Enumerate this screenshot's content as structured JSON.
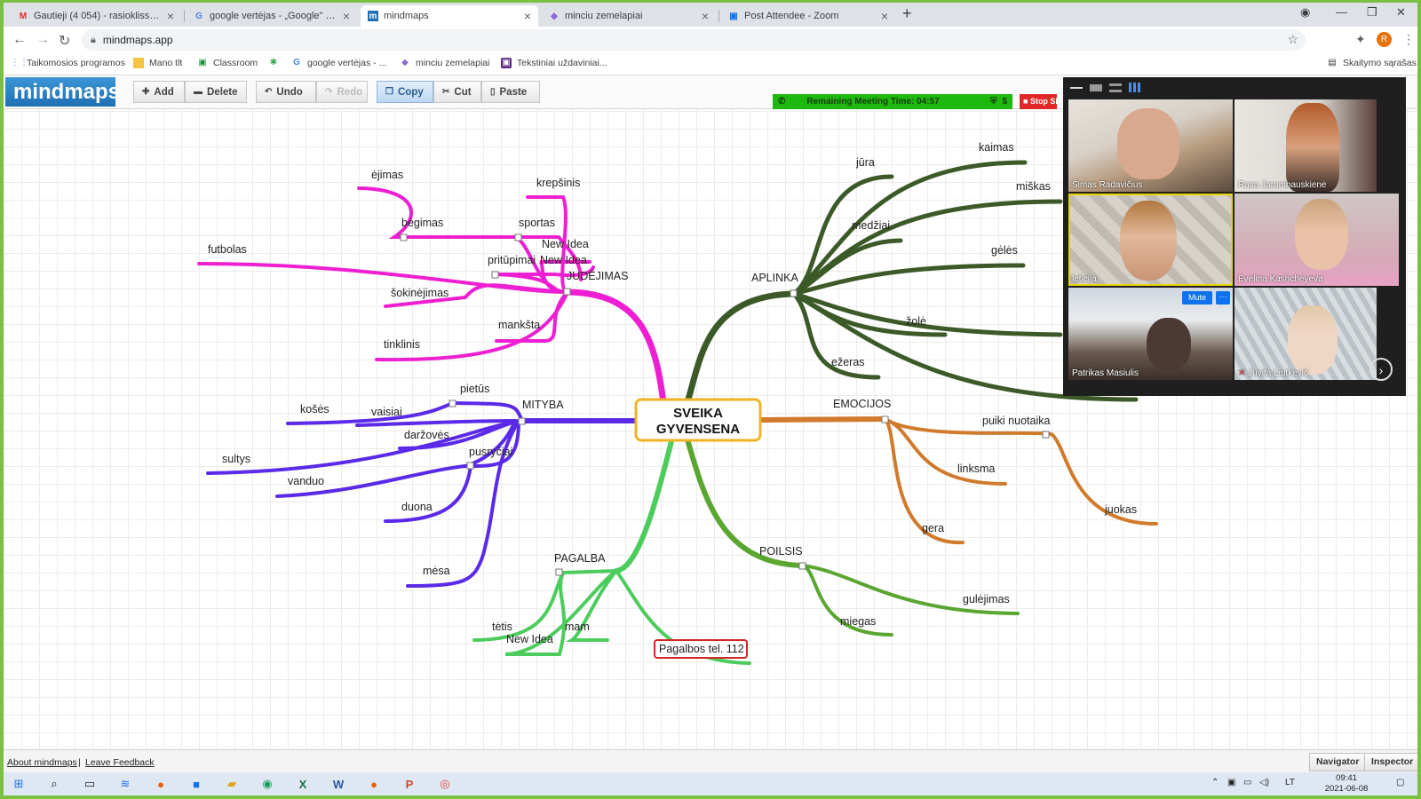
{
  "browser": {
    "tabs": [
      {
        "title": "Gautieji (4 054) - rasioklisster@g",
        "icon": "gmail-icon",
        "color": "#d93025",
        "glyph": "M"
      },
      {
        "title": "google vertėjas - „Google\" paieš",
        "icon": "google-icon",
        "color": "#4285f4",
        "glyph": "G"
      },
      {
        "title": "mindmaps",
        "icon": "mindmaps-icon",
        "color": "#1f6fb3",
        "glyph": "m",
        "active": true
      },
      {
        "title": "minciu zemelapiai",
        "icon": "drive-icon",
        "color": "#8c6ad0",
        "glyph": "◆"
      },
      {
        "title": "Post Attendee - Zoom",
        "icon": "zoom-icon",
        "color": "#0e72ed",
        "glyph": "▣"
      }
    ],
    "url": "mindmaps.app",
    "profile_initial": "R",
    "bookmarks": [
      {
        "label": "Taikomosios programos",
        "icon": "apps-icon",
        "glyph": "⋮⋮"
      },
      {
        "label": "Mano tlt",
        "icon": "folder-icon",
        "glyph": "▬"
      },
      {
        "label": "Classroom",
        "icon": "classroom-icon",
        "glyph": "▣"
      },
      {
        "label": "",
        "icon": "pinwheel-icon",
        "glyph": "✱"
      },
      {
        "label": "google vertėjas - ...",
        "icon": "google-icon",
        "glyph": "G"
      },
      {
        "label": "minciu zemelapiai",
        "icon": "drive-icon",
        "glyph": "◆"
      },
      {
        "label": "Tekstiniai uždaviniai...",
        "icon": "edu-icon",
        "glyph": "▣"
      }
    ],
    "reading_list": "Skaitymo sąrašas"
  },
  "toolbar": {
    "logo": "mindmaps",
    "add": "Add",
    "delete": "Delete",
    "undo": "Undo",
    "redo": "Redo",
    "copy": "Copy",
    "cut": "Cut",
    "paste": "Paste"
  },
  "meeting": {
    "remaining": "Remaining Meeting Time: 04:57",
    "stop_share": "Stop Sh",
    "participants": [
      {
        "name": "Šimas Radavičius"
      },
      {
        "name": "Rasa Jarumbauskienė"
      },
      {
        "name": "leticija"
      },
      {
        "name": "Evelina Kashcheyeva"
      },
      {
        "name": "Patrikas Masiulis"
      },
      {
        "name": "Juvita Liutkevič"
      }
    ],
    "mute_label": "Mute",
    "more_label": "···"
  },
  "mindmap": {
    "root": "SVEIKA\nGYVENSENA",
    "root_line1": "SVEIKA",
    "root_line2": "GYVENSENA",
    "branches": {
      "judejimas": {
        "label": "JUDĖJIMAS",
        "color": "#ee1fd2"
      },
      "mityba": {
        "label": "MITYBA",
        "color": "#5a2ae8"
      },
      "aplinka": {
        "label": "APLINKA",
        "color": "#3b5a28"
      },
      "emocijos": {
        "label": "EMOCIJOS",
        "color": "#d07a2c"
      },
      "poilsis": {
        "label": "POILSIS",
        "color": "#5aa630"
      },
      "pagalba": {
        "label": "PAGALBA",
        "color": "#4ccc5c"
      }
    },
    "nodes": {
      "ejimas": "ėjimas",
      "krepsinis": "krepšinis",
      "begimas": "bėgimas",
      "sportas": "sportas",
      "new_idea1": "New Idea",
      "pritupimai": "pritūpimai",
      "new_idea2": "New Idea",
      "futbolas": "futbolas",
      "sokinejimas": "šokinėjimas",
      "mankšta": "mankšta",
      "tinklinis": "tinklinis",
      "pietus": "pietūs",
      "koses": "košės",
      "vaisiai": "vaisiai",
      "darzoves": "daržovės",
      "sultys": "sultys",
      "pusryciai": "pusryčiai",
      "vanduo": "vanduo",
      "duona": "duona",
      "mesa": "mėsa",
      "jura": "jūra",
      "kaimas": "kaimas",
      "miskas": "miškas",
      "medziai": "medžiai",
      "geles": "gėlės",
      "zole": "žolė",
      "ezeras": "ežeras",
      "puiki": "puiki nuotaika",
      "linksma": "linksma",
      "juokas": "juokas",
      "gera": "gera",
      "gulejimas": "gulėjimas",
      "miegas": "miegas",
      "tetis": "tėtis",
      "mam": "mam",
      "new_idea3": "New Idea",
      "pagalbos": "Pagalbos tel. 112"
    }
  },
  "footer": {
    "about": "About mindmaps",
    "sep": "|",
    "feedback": "Leave Feedback",
    "navigator": "Navigator",
    "inspector": "Inspector"
  },
  "taskbar": {
    "lang": "LT",
    "time": "09:41",
    "date": "2021-06-08"
  }
}
